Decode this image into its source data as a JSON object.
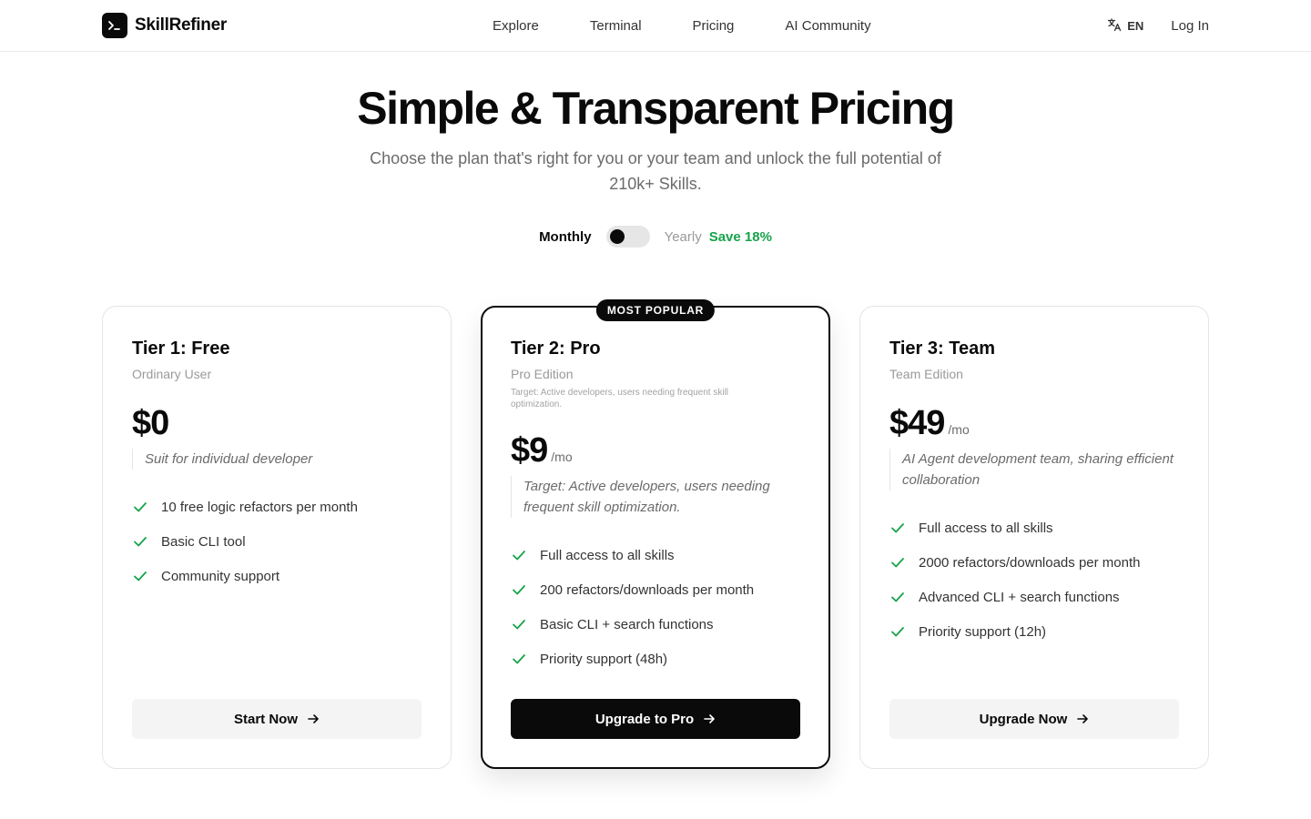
{
  "header": {
    "brand": "SkillRefiner",
    "nav": [
      {
        "label": "Explore"
      },
      {
        "label": "Terminal"
      },
      {
        "label": "Pricing"
      },
      {
        "label": "AI Community"
      }
    ],
    "lang": "EN",
    "login": "Log In"
  },
  "hero": {
    "title": "Simple & Transparent Pricing",
    "subtitle": "Choose the plan that's right for you or your team and unlock the full potential of 210k+ Skills."
  },
  "billing": {
    "monthly": "Monthly",
    "yearly": "Yearly",
    "save": "Save 18%",
    "selected": "Monthly"
  },
  "plans": [
    {
      "name": "Tier 1: Free",
      "edition": "Ordinary User",
      "price": "$0",
      "description": "Suit for individual developer",
      "features": [
        "10 free logic refactors per month",
        "Basic CLI tool",
        "Community support"
      ],
      "cta": "Start Now"
    },
    {
      "badge": "MOST POPULAR",
      "name": "Tier 2: Pro",
      "edition": "Pro Edition",
      "target": "Target: Active developers, users needing frequent skill optimization.",
      "price": "$9",
      "period": "/mo",
      "description": "Target: Active developers, users needing frequent skill optimization.",
      "features": [
        "Full access to all skills",
        "200 refactors/downloads per month",
        "Basic CLI + search functions",
        "Priority support (48h)"
      ],
      "cta": "Upgrade to Pro"
    },
    {
      "name": "Tier 3: Team",
      "edition": "Team Edition",
      "price": "$49",
      "period": "/mo",
      "description": "AI Agent development team, sharing efficient collaboration",
      "features": [
        "Full access to all skills",
        "2000 refactors/downloads per month",
        "Advanced CLI + search functions",
        "Priority support (12h)"
      ],
      "cta": "Upgrade Now"
    }
  ],
  "colors": {
    "accent_green": "#16a34a",
    "primary": "#0a0a0a",
    "muted": "#6b6b6b"
  },
  "icons": {
    "brand": "terminal-icon",
    "lang": "translate-icon",
    "feature": "check-icon",
    "cta": "arrow-right-icon"
  }
}
